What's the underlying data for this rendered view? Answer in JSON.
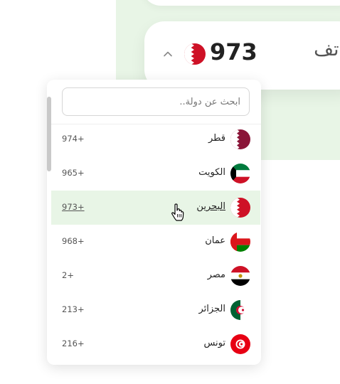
{
  "phone": {
    "label": "هاتف",
    "code": "973",
    "flag_icon": "bahrain-flag-icon",
    "chevron_icon": "chevron-up-icon"
  },
  "dropdown": {
    "search_placeholder": "ابحث عن دولة..",
    "countries": [
      {
        "name": "قطر",
        "dial": "974+",
        "flag": "qatar-flag-icon"
      },
      {
        "name": "الكويت",
        "dial": "965+",
        "flag": "kuwait-flag-icon"
      },
      {
        "name": "البحرين",
        "dial": "973+",
        "flag": "bahrain-flag-icon",
        "selected": true
      },
      {
        "name": "عمان",
        "dial": "968+",
        "flag": "oman-flag-icon"
      },
      {
        "name": "مصر",
        "dial": "2+",
        "flag": "egypt-flag-icon"
      },
      {
        "name": "الجزائر",
        "dial": "213+",
        "flag": "algeria-flag-icon"
      },
      {
        "name": "تونس",
        "dial": "216+",
        "flag": "tunisia-flag-icon"
      }
    ]
  },
  "colors": {
    "panel_green": "#e8f5e6",
    "selected_row": "#e8f5e6",
    "bahrain_red": "#ce1126",
    "qatar_maroon": "#8a1538"
  }
}
